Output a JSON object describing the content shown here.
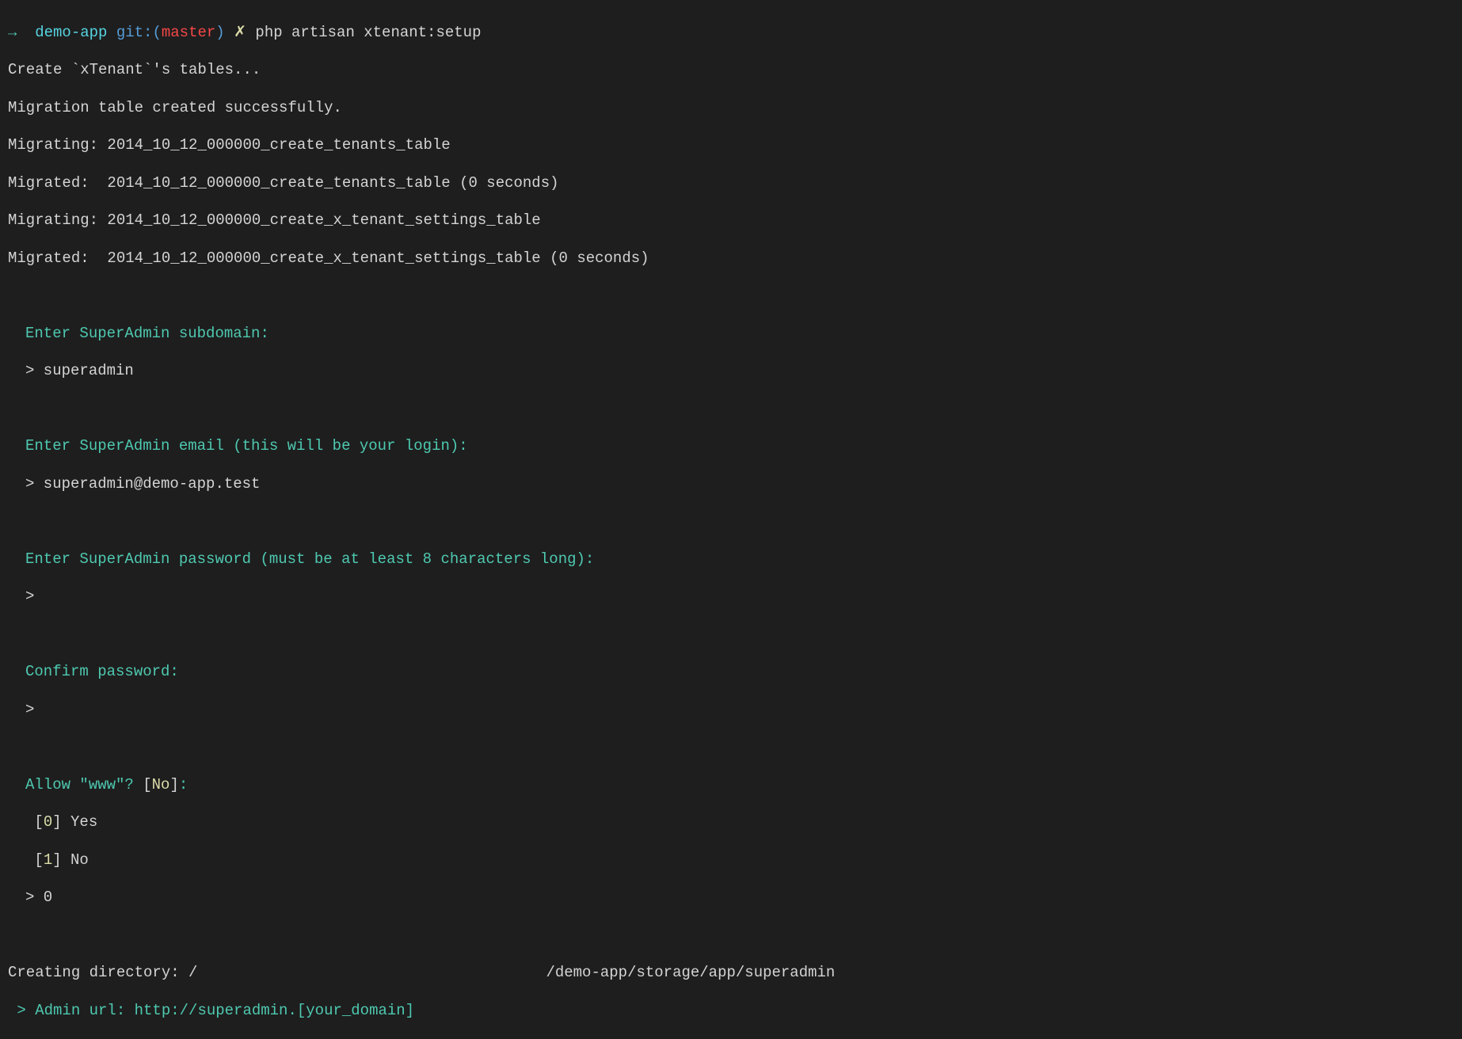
{
  "prompt": {
    "arrow": "→",
    "dir": "demo-app",
    "git_label": "git:(",
    "branch": "master",
    "git_close": ")",
    "dirty": "✗",
    "command": "php artisan xtenant:setup"
  },
  "output": {
    "l1": "Create `xTenant`'s tables...",
    "l2": "Migration table created successfully.",
    "l3": "Migrating: 2014_10_12_000000_create_tenants_table",
    "l4": "Migrated:  2014_10_12_000000_create_tenants_table (0 seconds)",
    "l5": "Migrating: 2014_10_12_000000_create_x_tenant_settings_table",
    "l6": "Migrated:  2014_10_12_000000_create_x_tenant_settings_table (0 seconds)"
  },
  "q1": {
    "prompt": "Enter SuperAdmin subdomain:",
    "answer": "> superadmin"
  },
  "q2": {
    "prompt": "Enter SuperAdmin email (this will be your login):",
    "answer": "> superadmin@demo-app.test"
  },
  "q3": {
    "prompt": "Enter SuperAdmin password (must be at least 8 characters long):",
    "answer": ">"
  },
  "q4": {
    "prompt": "Confirm password:",
    "answer": ">"
  },
  "q5": {
    "prompt_pre": "Allow \"www\"? ",
    "bracket_open": "[",
    "default": "No",
    "bracket_close": "]",
    "colon": ":",
    "opt0_b": "[",
    "opt0_n": "0",
    "opt0_c": "] Yes",
    "opt1_b": "[",
    "opt1_n": "1",
    "opt1_c": "] No",
    "answer": "> 0"
  },
  "footer": {
    "creating_pre": "Creating directory: /",
    "creating_post": "/demo-app/storage/app/superadmin",
    "admin_url": " > Admin url: http://superadmin.[your_domain]"
  }
}
